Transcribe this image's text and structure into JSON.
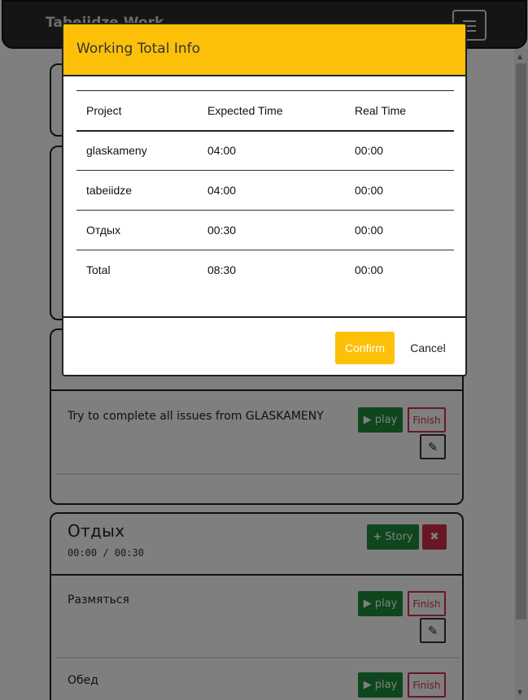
{
  "navbar": {
    "brand": "Tabeiidze Work"
  },
  "project_card": {
    "task": {
      "title": "Try to complete all issues from GLASKAMENY",
      "play_label": "play",
      "finish_label": "Finish"
    }
  },
  "rest_card": {
    "title": "Отдых",
    "times": "00:00 / 00:30",
    "story_label": "Story",
    "delete_label": "✖",
    "tasks": [
      {
        "title": "Размяться",
        "play_label": "play",
        "finish_label": "Finish"
      },
      {
        "title": "Обед",
        "play_label": "play",
        "finish_label": "Finish"
      }
    ]
  },
  "modal": {
    "title": "Working Total Info",
    "columns": [
      "Project",
      "Expected Time",
      "Real Time"
    ],
    "rows": [
      [
        "glaskameny",
        "04:00",
        "00:00"
      ],
      [
        "tabeiidze",
        "04:00",
        "00:00"
      ],
      [
        "Отдых",
        "00:30",
        "00:00"
      ],
      [
        "Total",
        "08:30",
        "00:00"
      ]
    ],
    "confirm_label": "Confirm",
    "cancel_label": "Cancel"
  },
  "icons": {
    "menu": "hamburger-icon",
    "play": "play-icon",
    "edit": "pencil-icon",
    "add": "plus-icon",
    "delete": "close-icon"
  },
  "colors": {
    "accent": "#fdc009",
    "success": "#1e8c3a",
    "danger": "#d0314a",
    "navbar": "#2b2b2b"
  }
}
